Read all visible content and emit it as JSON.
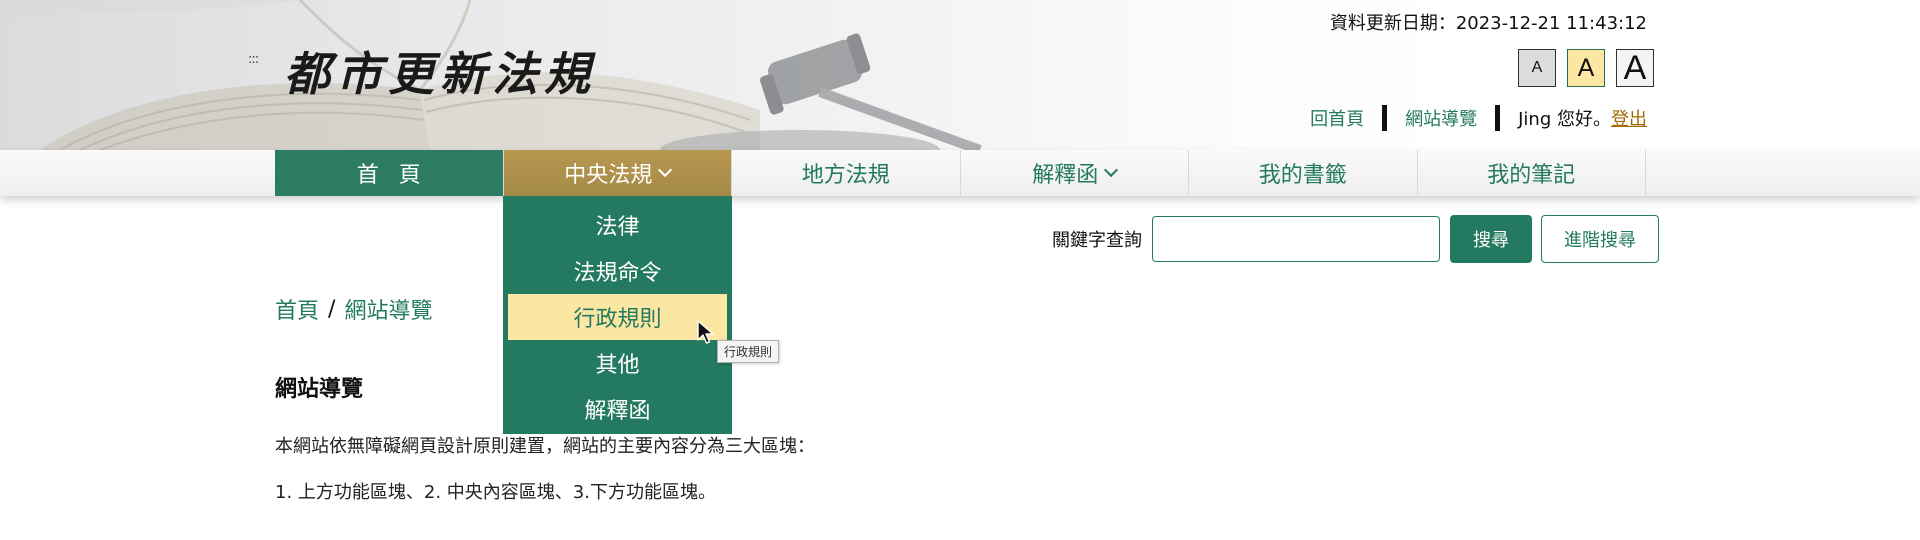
{
  "header": {
    "site_title": "都市更新法規",
    "grip_glyph": ":::",
    "update_date": "資料更新日期：2023-12-21 11:43:12",
    "font_size_buttons": [
      "A",
      "A",
      "A"
    ],
    "links": {
      "home": "回首頁",
      "sitemap": "網站導覽",
      "greeting": "Jing 您好。",
      "logout": "登出"
    }
  },
  "nav": {
    "home": "首頁",
    "central": "中央法規",
    "local": "地方法規",
    "interpretation": "解釋函",
    "bookmarks": "我的書籤",
    "notes": "我的筆記"
  },
  "dropdown": {
    "items": [
      "法律",
      "法規命令",
      "行政規則",
      "其他",
      "解釋函"
    ],
    "hovered_index": 2,
    "tooltip": "行政規則"
  },
  "search": {
    "label": "關鍵字查詢",
    "value": "",
    "search_button": "搜尋",
    "advanced_button": "進階搜尋"
  },
  "main": {
    "breadcrumb": [
      "首頁",
      "網站導覽"
    ],
    "breadcrumb_sep": "/",
    "title": "網站導覽",
    "paragraphs": [
      "本網站依無障礙網頁設計原則建置，網站的主要內容分為三大區塊：",
      "1. 上方功能區塊、2. 中央內容區塊、3.下方功能區塊。"
    ]
  },
  "colors": {
    "primary_green": "#237a60",
    "active_gold": "#b89850",
    "highlight_yellow": "#fbe6a3",
    "logout_link": "#a36a00"
  },
  "icons": [
    "grip-icon",
    "chevron-down-icon",
    "mouse-pointer-icon",
    "book-photo",
    "gavel-photo"
  ]
}
